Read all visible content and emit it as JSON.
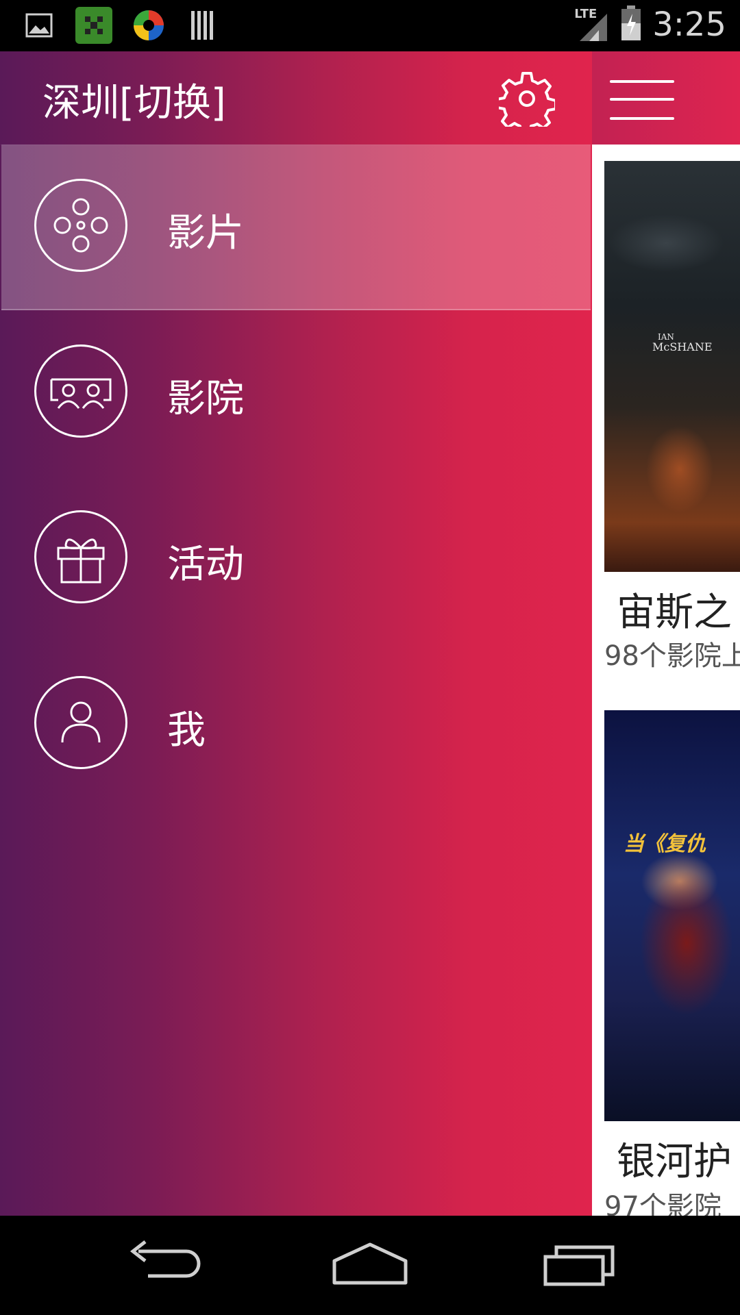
{
  "status_bar": {
    "time": "3:25",
    "network": "LTE",
    "notification_icons": [
      "image-icon",
      "app-icon",
      "browser-icon",
      "barcode-icon"
    ]
  },
  "drawer": {
    "city_label": "深圳[切换]",
    "items": [
      {
        "label": "影片",
        "icon": "film-reel-icon",
        "active": true
      },
      {
        "label": "影院",
        "icon": "cinema-seats-icon",
        "active": false
      },
      {
        "label": "活动",
        "icon": "gift-icon",
        "active": false
      },
      {
        "label": "我",
        "icon": "person-icon",
        "active": false
      }
    ]
  },
  "content": {
    "movies": [
      {
        "title": "宙斯之",
        "subtitle": "98个影院上",
        "poster_text_1": "IAN",
        "poster_text_2": "McSHANE"
      },
      {
        "title": "银河护",
        "subtitle": "97个影院",
        "poster_tag": "当《复仇"
      }
    ]
  },
  "colors": {
    "gradient_start": "#5a1a58",
    "gradient_end": "#e0244d"
  }
}
